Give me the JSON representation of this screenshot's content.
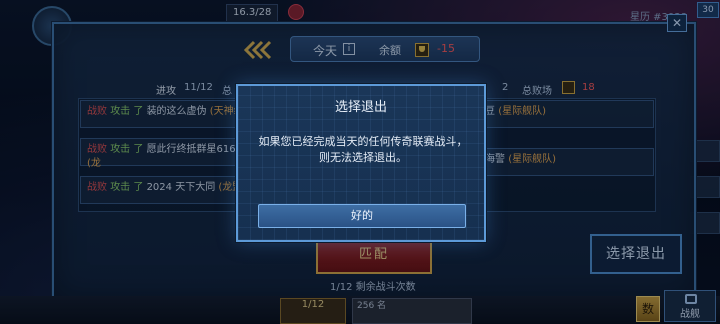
{
  "header": {
    "stat": "16.3/28",
    "right_text": "星历 #3038",
    "right_badge": "30"
  },
  "panel": {
    "today": "今天",
    "balance_label": "余额",
    "balance_value": "-15",
    "attack_label": "进攻",
    "attack_value": "11/12",
    "total_prefix": "总",
    "defend_value": "2",
    "total_label": "总败场",
    "total_value": "18"
  },
  "logs": [
    {
      "result": "战败",
      "action": "攻击 了",
      "text": "装的这么虚伪",
      "team": "(天神组)"
    },
    {
      "result": "战败",
      "action": "攻击 了",
      "text": "愿此行终抵群星616",
      "team": "(龙"
    },
    {
      "result": "战败",
      "action": "攻击 了",
      "text": "2024 天下大同",
      "team": "(龙盟"
    },
    {
      "text": "豆",
      "team": "(星际舰队)"
    },
    {
      "text": "海警",
      "team": "(星际舰队)"
    }
  ],
  "battle_button": "匹配",
  "remaining": "1/12 剩余战斗次数",
  "select_exit_button": "选择退出",
  "bottom": {
    "card_value": "1/12",
    "mid_line1": "256 名",
    "fight_label": "战舰"
  },
  "modal": {
    "title": "选择退出",
    "body": "如果您已经完成当天的任何传奇联赛战斗，则无法选择退出。",
    "ok": "好的"
  },
  "colors": {
    "panel_border": "#3f73a8",
    "modal_border": "#5d9ad8",
    "loss_red": "#e05050",
    "action_green": "#8fd06a",
    "team_gold": "#e8a850",
    "negative": "#ff5a5a"
  }
}
